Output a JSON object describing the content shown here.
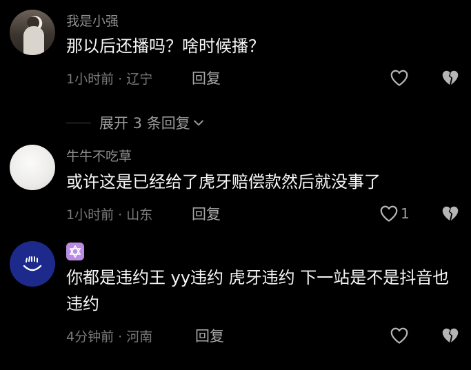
{
  "comments": [
    {
      "username": "我是小强",
      "text": "那以后还播吗？啥时候播？",
      "time": "1小时前",
      "separator": "·",
      "location": "辽宁",
      "reply_label": "回复",
      "like_count": ""
    },
    {
      "username": "牛牛不吃草",
      "text": "或许这是已经给了虎牙赔偿款然后就没事了",
      "time": "1小时前",
      "separator": "·",
      "location": "山东",
      "reply_label": "回复",
      "like_count": "1"
    },
    {
      "username": "",
      "text": "你都是违约王 yy违约 虎牙违约 下一站是不是抖音也违约",
      "time": "4分钟前",
      "separator": "·",
      "location": "河南",
      "reply_label": "回复",
      "like_count": ""
    }
  ],
  "expand_replies": {
    "label": "展开 3 条回复"
  },
  "colors": {
    "background": "#000000",
    "primary_text": "#f5f5f5",
    "secondary_text": "#8e8e8e",
    "badge": "#b98be6",
    "avatar_blue": "#1d2a8c"
  },
  "icons": [
    "heart-outline-icon",
    "broken-heart-icon",
    "chevron-down-icon",
    "star-of-david-icon"
  ]
}
